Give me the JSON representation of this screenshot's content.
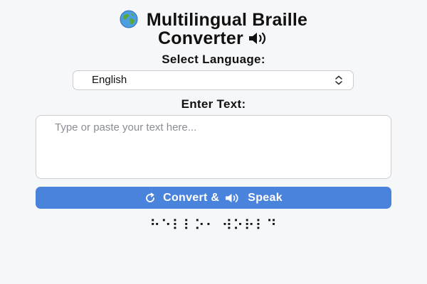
{
  "header": {
    "title_line1": "Multilingual Braille",
    "title_line2": "Converter",
    "globe_icon": "globe-icon",
    "speaker_icon": "speaker-icon"
  },
  "language": {
    "label": "Select Language:",
    "selected": "English"
  },
  "text_input": {
    "label": "Enter Text:",
    "value": "",
    "placeholder": "Type or paste your text here..."
  },
  "convert_button": {
    "label_part1": "Convert &",
    "label_part2": "Speak",
    "refresh_icon": "refresh-icon",
    "speaker_icon": "speaker-icon"
  },
  "output": {
    "braille": "⠓⠑⠇⠇⠕⠂ ⠺⠕⠗⠇⠙"
  },
  "colors": {
    "accent": "#4a83db",
    "background": "#f6f7f9"
  }
}
